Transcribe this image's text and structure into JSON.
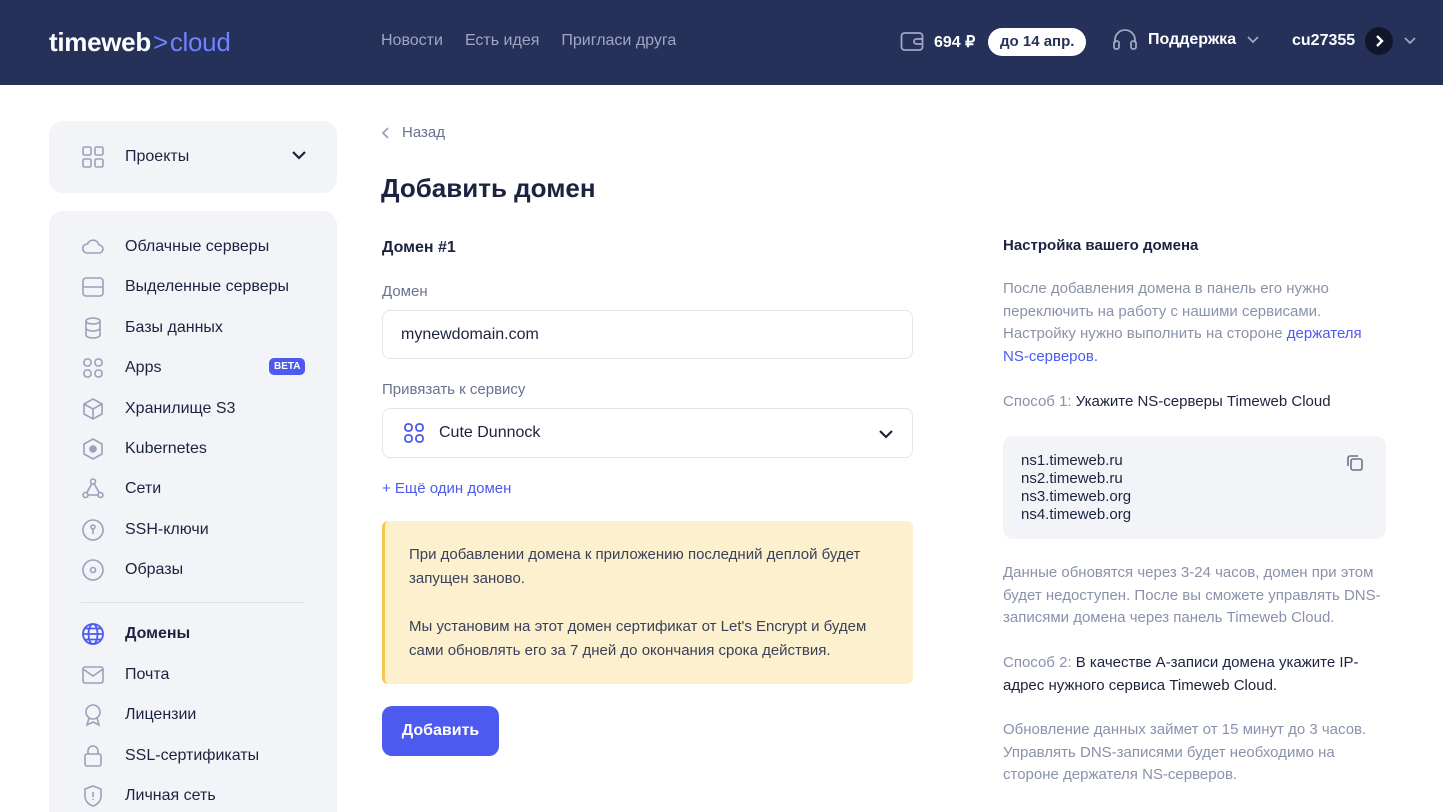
{
  "header": {
    "logo_main": "timeweb",
    "logo_chevron": ">",
    "logo_cloud": "cloud",
    "nav": [
      "Новости",
      "Есть идея",
      "Пригласи друга"
    ],
    "balance": "694 ₽",
    "due": "до 14 апр.",
    "support": "Поддержка",
    "username": "cu27355"
  },
  "sidebar": {
    "projects_label": "Проекты",
    "items": [
      {
        "label": "Облачные серверы",
        "icon": "cloud-icon"
      },
      {
        "label": "Выделенные серверы",
        "icon": "server-icon"
      },
      {
        "label": "Базы данных",
        "icon": "database-icon"
      },
      {
        "label": "Apps",
        "icon": "apps-icon",
        "badge": "BETA"
      },
      {
        "label": "Хранилище S3",
        "icon": "box-icon"
      },
      {
        "label": "Kubernetes",
        "icon": "kubernetes-icon"
      },
      {
        "label": "Сети",
        "icon": "network-icon"
      },
      {
        "label": "SSH-ключи",
        "icon": "key-icon"
      },
      {
        "label": "Образы",
        "icon": "disc-icon"
      },
      {
        "label": "Домены",
        "icon": "globe-icon",
        "active": true
      },
      {
        "label": "Почта",
        "icon": "mail-icon"
      },
      {
        "label": "Лицензии",
        "icon": "license-icon"
      },
      {
        "label": "SSL-сертификаты",
        "icon": "lock-icon"
      },
      {
        "label": "Личная сеть",
        "icon": "shield-icon"
      }
    ]
  },
  "main": {
    "back_label": "Назад",
    "title": "Добавить домен",
    "section_title": "Домен #1",
    "domain_label": "Домен",
    "domain_value": "mynewdomain.com",
    "service_label": "Привязать к сервису",
    "service_value": "Cute Dunnock",
    "add_more": "+ Ещё один домен",
    "notice": [
      "При добавлении домена к приложению последний деплой будет запущен заново.",
      "Мы установим на этот домен сертификат от Let's Encrypt и будем сами обновлять его за 7 дней до окончания срока действия."
    ],
    "submit": "Добавить"
  },
  "info": {
    "title": "Настройка вашего домена",
    "intro": "После добавления домена в панель его нужно переключить на работу с нашими сервисами. Настройку нужно выполнить на стороне ",
    "intro_link": "держателя NS-серверов.",
    "method1_prefix": "Способ 1: ",
    "method1_text": "Укажите NS-серверы Timeweb Cloud",
    "ns_servers": [
      "ns1.timeweb.ru",
      "ns2.timeweb.ru",
      "ns3.timeweb.org",
      "ns4.timeweb.org"
    ],
    "method1_note": "Данные обновятся через 3-24 часов, домен при этом будет недоступен. После вы сможете управлять DNS-записями домена через панель Timeweb Cloud.",
    "method2_prefix": "Способ 2: ",
    "method2_text": "В качестве А-записи домена укажите IP-адрес нужного сервиса Timeweb Cloud.",
    "method2_note": "Обновление данных займет от 15 минут до 3 часов. Управлять DNS-записями будет необходимо на стороне держателя NS-серверов."
  },
  "colors": {
    "header_bg": "#253159",
    "accent": "#4c5af0",
    "notice_bg": "#fcf0cf",
    "notice_border": "#f5c84c",
    "panel_bg": "#f3f4f8"
  }
}
